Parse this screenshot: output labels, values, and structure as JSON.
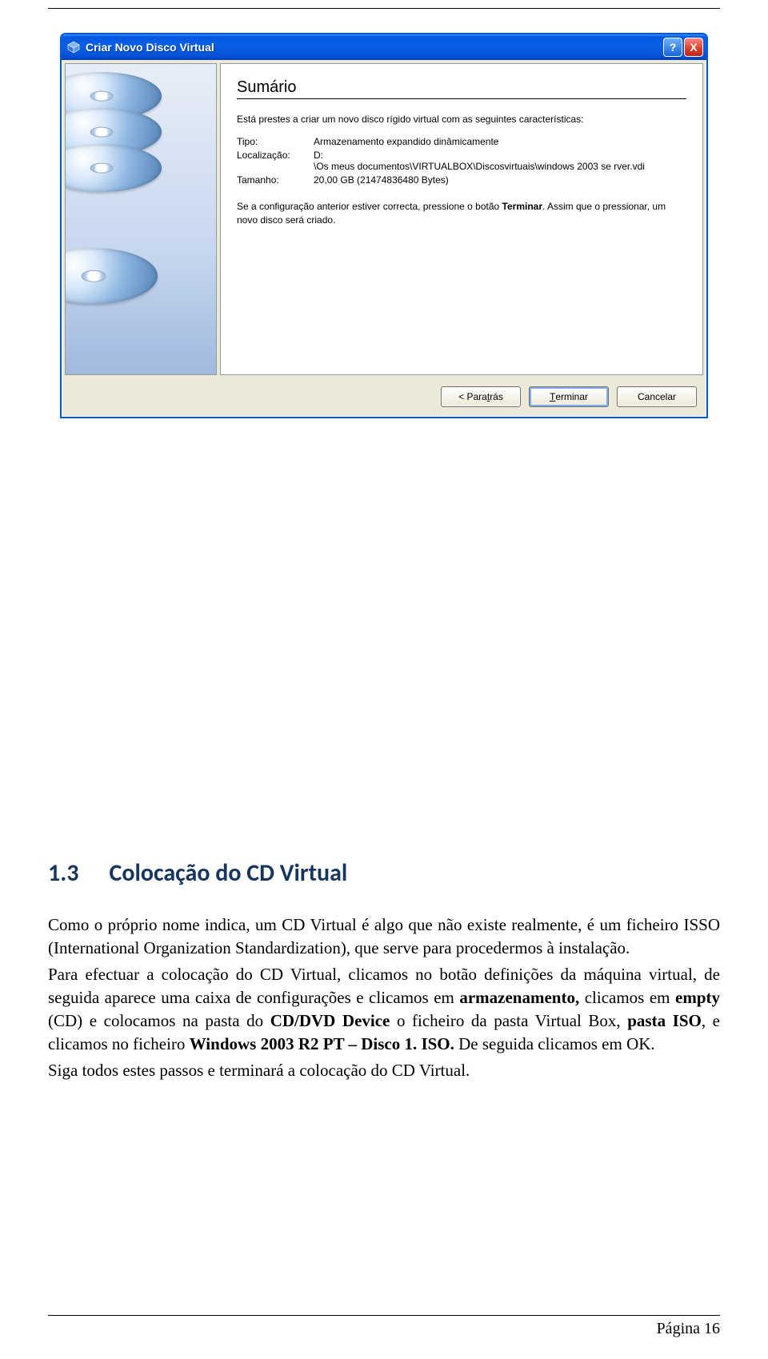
{
  "dialog": {
    "title": "Criar Novo Disco Virtual",
    "help": "?",
    "close": "X",
    "heading": "Sumário",
    "intro": "Está prestes a criar um novo disco rígido virtual com as seguintes características:",
    "rows": {
      "tipo_k": "Tipo:",
      "tipo_v": "Armazenamento expandido dinâmicamente",
      "loc_k": "Localização:",
      "loc_v1": "D:",
      "loc_v2": "\\Os meus documentos\\VIRTUALBOX\\Discosvirtuais\\windows 2003 se rver.vdi",
      "tam_k": "Tamanho:",
      "tam_v": "20,00 GB (21474836480 Bytes)"
    },
    "footnote_a": "Se a configuração anterior estiver correcta, pressione o botão ",
    "footnote_b": "Terminar",
    "footnote_c": ". Assim que o pressionar, um novo disco será criado.",
    "btn_back_a": "< Para ",
    "btn_back_b": "t",
    "btn_back_c": "rás",
    "btn_finish_a": "T",
    "btn_finish_b": "erminar",
    "btn_cancel": "Cancelar"
  },
  "section": {
    "number": "1.3",
    "title": "Colocação do CD Virtual"
  },
  "para1": "Como o próprio nome indica, um CD Virtual é algo que não existe realmente, é um ficheiro ISSO (International Organization Standardization), que serve para procedermos à instalação.",
  "para2_a": "Para efectuar a colocação do CD Virtual, clicamos no botão definições da máquina virtual, de seguida aparece uma caixa de configurações e clicamos em ",
  "para2_b": "armazenamento,",
  "para2_c": " clicamos em ",
  "para2_d": "empty",
  "para2_e": " (CD) e colocamos na pasta do ",
  "para2_f": "CD/DVD Device",
  "para2_g": " o ficheiro da pasta Virtual Box, ",
  "para2_h": "pasta ISO",
  "para2_i": ", e clicamos no ficheiro ",
  "para2_j": "Windows 2003 R2 PT – Disco 1. ISO.",
  "para2_k": " De seguida clicamos em OK.",
  "para3": "Siga todos estes passos e terminará a colocação do CD Virtual.",
  "footer": "Página 16"
}
